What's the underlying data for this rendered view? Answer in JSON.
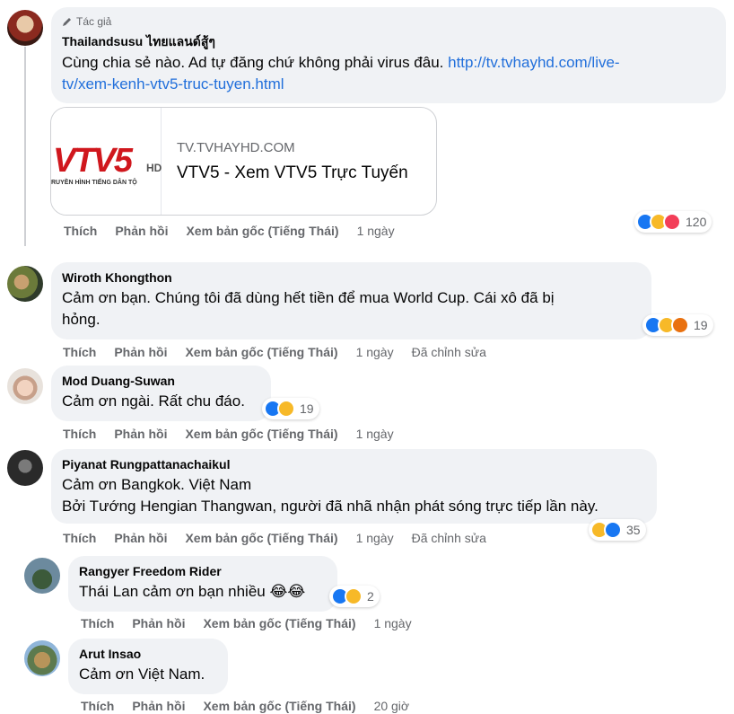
{
  "comments": [
    {
      "badge": "Tác giả",
      "author": "Thailandsusu ไทยแลนด์สู้ๆ",
      "text": "Cùng chia sẻ nào. Ad tự đăng chứ không phải virus đâu. ",
      "link": "http://tv.tvhayhd.com/live-tv/xem-kenh-vtv5-truc-tuyen.html",
      "link_line1": "http://tv.tvhayhd.com/live-",
      "link_line2": "tv/xem-kenh-vtv5-truc-tuyen.html",
      "card": {
        "domain": "TV.TVHAYHD.COM",
        "title": "VTV5 - Xem VTV5 Trực Tuyến",
        "logo_text": "VTV5",
        "logo_hd": "HD",
        "logo_sub": "RUYỀN HÌNH TIẾNG DÂN TỘ"
      },
      "actions": {
        "like": "Thích",
        "reply": "Phản hồi",
        "original": "Xem bản gốc (Tiếng Thái)",
        "time": "1 ngày"
      },
      "reaction_count": "120"
    },
    {
      "author": "Wiroth Khongthon",
      "text_line1": "Cảm ơn bạn. Chúng tôi đã dùng hết tiền để mua World Cup. Cái xô đã bị",
      "text_line2": "hỏng.",
      "actions": {
        "like": "Thích",
        "reply": "Phản hồi",
        "original": "Xem bản gốc (Tiếng Thái)",
        "time": "1 ngày",
        "edited": "Đã chỉnh sửa"
      },
      "reaction_count": "19"
    },
    {
      "author": "Mod Duang-Suwan",
      "text": "Cảm ơn ngài. Rất chu đáo.",
      "actions": {
        "like": "Thích",
        "reply": "Phản hồi",
        "original": "Xem bản gốc (Tiếng Thái)",
        "time": "1 ngày"
      },
      "reaction_count": "19"
    },
    {
      "author": "Piyanat Rungpattanachaikul",
      "text_line1": "Cảm ơn Bangkok. Việt Nam",
      "text_line2": "Bởi Tướng Hengian Thangwan, người đã nhã nhận phát sóng trực tiếp lần này.",
      "actions": {
        "like": "Thích",
        "reply": "Phản hồi",
        "original": "Xem bản gốc (Tiếng Thái)",
        "time": "1 ngày",
        "edited": "Đã chỉnh sửa"
      },
      "reaction_count": "35"
    },
    {
      "author": "Rangyer Freedom Rider",
      "text": "Thái Lan cảm ơn bạn nhiều 😂😂",
      "actions": {
        "like": "Thích",
        "reply": "Phản hồi",
        "original": "Xem bản gốc (Tiếng Thái)",
        "time": "1 ngày"
      },
      "reaction_count": "2"
    },
    {
      "author": "Arut Insao",
      "text": "Cảm ơn Việt Nam.",
      "actions": {
        "like": "Thích",
        "reply": "Phản hồi",
        "original": "Xem bản gốc (Tiếng Thái)",
        "time": "20 giờ"
      }
    }
  ],
  "colors": {
    "bubble": "#f0f2f5",
    "link": "#216fdb",
    "muted": "#65676b",
    "like": "#1877f2",
    "haha": "#f7b928",
    "angry": "#e9710f",
    "love": "#f33e58"
  }
}
